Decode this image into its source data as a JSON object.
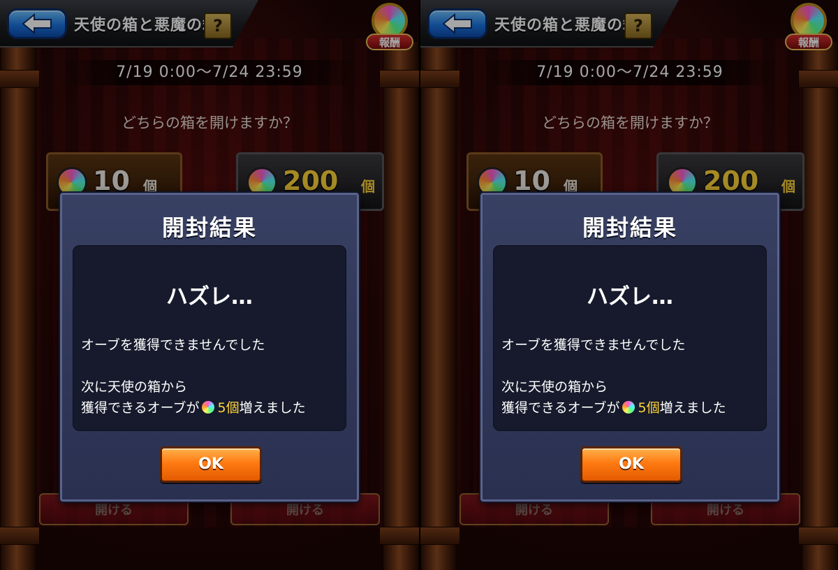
{
  "screens": [
    {
      "header": {
        "title": "天使の箱と悪魔の箱",
        "help_label": "?",
        "reward_label": "報酬"
      },
      "period": "7/19 0:00〜7/24 23:59",
      "question": "どちらの箱を開けますか？",
      "angel_box": {
        "amount": "10",
        "unit": "個",
        "open_label": "開ける"
      },
      "devil_box": {
        "amount": "200",
        "unit": "個",
        "open_label": "開ける"
      },
      "modal": {
        "title": "開封結果",
        "result": "ハズレ…",
        "message_1": "オーブを獲得できませんでした",
        "message_2": "次に天使の箱から",
        "message_3_prefix": "獲得できるオーブが",
        "message_3_amount": "5個",
        "message_3_suffix": "増えました",
        "ok_label": "OK"
      }
    },
    {
      "header": {
        "title": "天使の箱と悪魔の箱",
        "help_label": "?",
        "reward_label": "報酬"
      },
      "period": "7/19 0:00〜7/24 23:59",
      "question": "どちらの箱を開けますか？",
      "angel_box": {
        "amount": "10",
        "unit": "個",
        "open_label": "開ける"
      },
      "devil_box": {
        "amount": "200",
        "unit": "個",
        "open_label": "開ける"
      },
      "modal": {
        "title": "開封結果",
        "result": "ハズレ…",
        "message_1": "オーブを獲得できませんでした",
        "message_2": "次に天使の箱から",
        "message_3_prefix": "獲得できるオーブが",
        "message_3_amount": "5個",
        "message_3_suffix": "増えました",
        "ok_label": "OK"
      }
    }
  ],
  "colors": {
    "accent_orange": "#ff7a12",
    "highlight_yellow": "#ffd53a",
    "modal_bg": "#384063",
    "back_blue": "#1c74e0"
  },
  "icons": {
    "back": "back-arrow-icon",
    "orb": "orb-icon"
  }
}
